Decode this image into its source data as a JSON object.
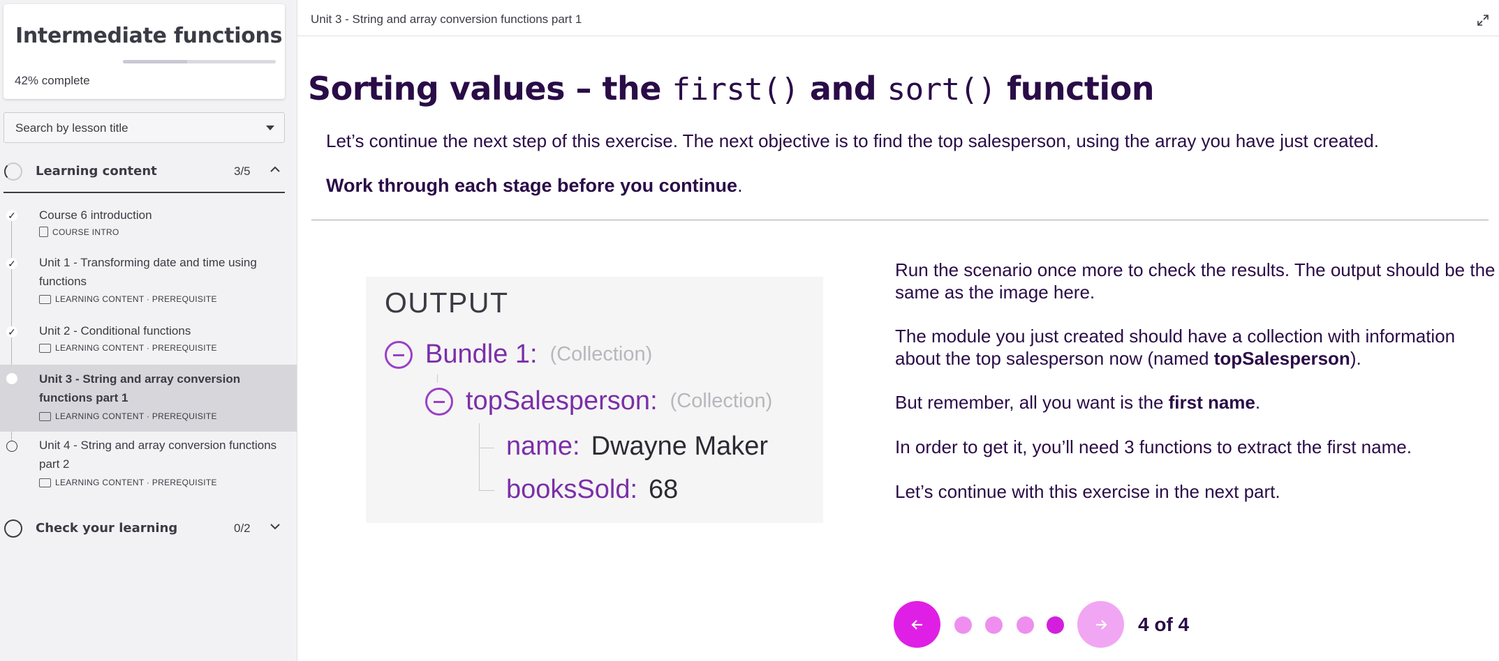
{
  "sidebar": {
    "course_title": "Intermediate functions",
    "progress_percent": 42,
    "progress_label_value": "42%",
    "progress_label_suffix": " complete",
    "search_placeholder": "Search by lesson title",
    "sections": [
      {
        "label": "Learning content",
        "count": "3/5",
        "expanded": true
      },
      {
        "label": "Check your learning",
        "count": "0/2",
        "expanded": false
      }
    ],
    "lessons": [
      {
        "title": "Course 6 introduction",
        "meta": "COURSE INTRO",
        "status": "complete",
        "icon": "document-icon"
      },
      {
        "title": "Unit 1 - Transforming date and time using functions",
        "meta": "LEARNING CONTENT · PREREQUISITE",
        "status": "complete",
        "icon": "slides-icon"
      },
      {
        "title": "Unit 2 - Conditional functions",
        "meta": "LEARNING CONTENT · PREREQUISITE",
        "status": "complete",
        "icon": "slides-icon"
      },
      {
        "title": "Unit 3 - String and array conversion functions part 1",
        "meta": "LEARNING CONTENT · PREREQUISITE",
        "status": "current",
        "icon": "slides-icon"
      },
      {
        "title": "Unit 4 - String and array conversion functions part 2",
        "meta": "LEARNING CONTENT · PREREQUISITE",
        "status": "not-started",
        "icon": "slides-icon"
      }
    ]
  },
  "main": {
    "breadcrumb": "Unit 3 - String and array conversion functions part 1",
    "heading": {
      "part1": "Sorting values – the ",
      "code1": "first()",
      "part2": " and ",
      "code2": "sort()",
      "part3": " function"
    },
    "intro": "Let’s continue the next step of this exercise. The next objective is to find the top salesperson, using the array you have just created.",
    "emphasis": "Work through each stage before you continue",
    "emphasis_end": ".",
    "output_panel": {
      "title": "OUTPUT",
      "bundle_key": "Bundle 1:",
      "bundle_type": "(Collection)",
      "child_key": "topSalesperson:",
      "child_type": "(Collection)",
      "fields": [
        {
          "key": "name:",
          "value": "Dwayne Maker"
        },
        {
          "key": "booksSold:",
          "value": "68"
        }
      ]
    },
    "paragraphs": {
      "p1": "Run the scenario once more to check the results. The output should be the same as the image here.",
      "p2_a": "The module you just created should have a collection with information about the top salesperson now (named ",
      "p2_b": "topSalesperson",
      "p2_c": ").",
      "p3_a": "But remember, all you want is the ",
      "p3_b": "first name",
      "p3_c": ".",
      "p4": "In order to get it, you’ll need 3 functions to extract the first name.",
      "p5": "Let’s continue with this exercise in the next part."
    },
    "pagination": {
      "total": 4,
      "current": 4,
      "label": "4 of 4"
    }
  },
  "colors": {
    "accent": "#e01fe6",
    "accent_light": "#f1a6f3",
    "heading_text": "#2a0c47",
    "output_key": "#7b2fa8"
  }
}
